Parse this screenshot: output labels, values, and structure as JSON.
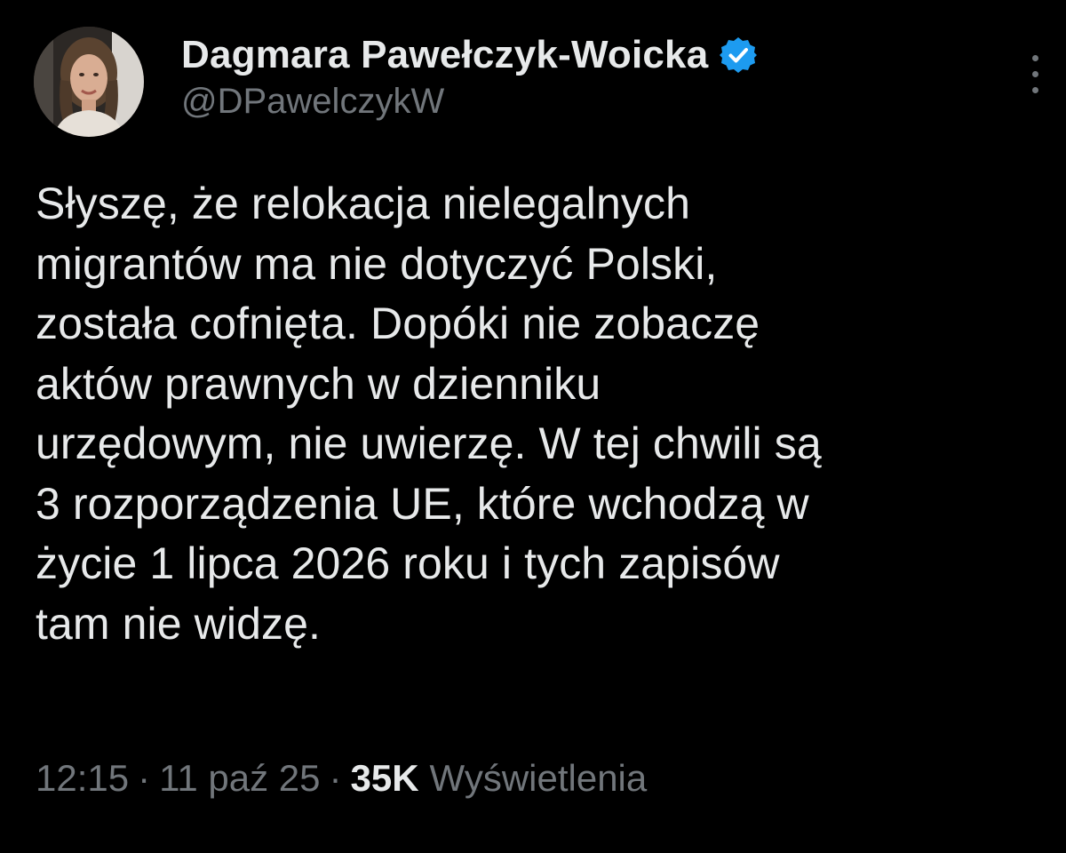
{
  "author": {
    "display_name": "Dagmara Pawełczyk-Woicka",
    "handle": "@DPawelczykW",
    "verified_icon": "verified-badge-icon",
    "verified_color": "#1d9bf0"
  },
  "tweet": {
    "text": "Słyszę, że relokacja nielegalnych\nmigrantów ma nie dotyczyć Polski,\nzostała cofnięta. Dopóki nie zobaczę\naktów prawnych w dzienniku\nurzędowym, nie uwierzę. W tej chwili są\n3 rozporządzenia UE, które wchodzą w\nżycie 1 lipca 2026 roku i tych zapisów\ntam nie widzę."
  },
  "meta": {
    "time": "12:15",
    "separator": "·",
    "date": "11 paź 25",
    "views_count": "35K",
    "views_label": "Wyświetlenia"
  },
  "colors": {
    "background": "#000000",
    "primary_text": "#e7e9ea",
    "secondary_text": "#71767b"
  }
}
